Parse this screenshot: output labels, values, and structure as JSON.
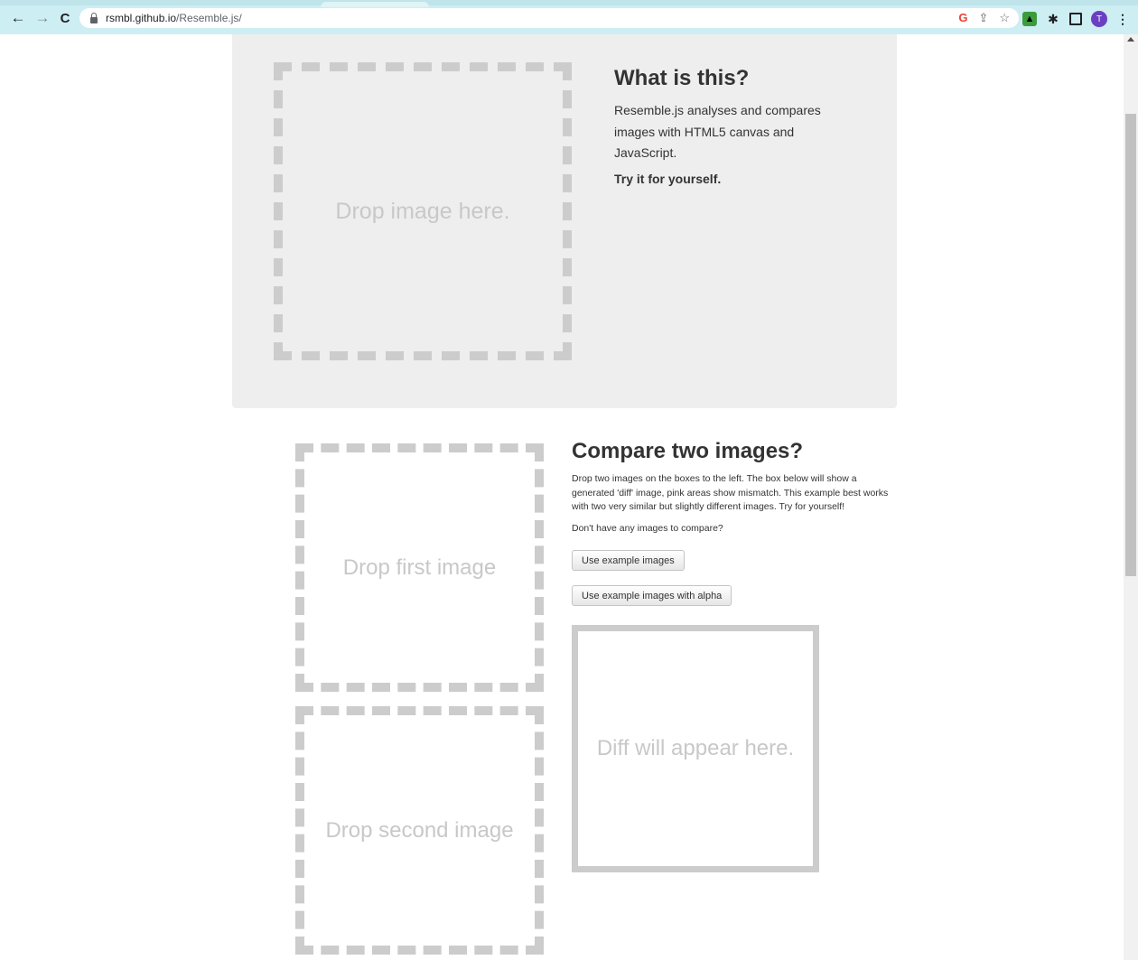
{
  "browser": {
    "url_host": "rsmbl.github.io",
    "url_path": "/Resemble.js/",
    "avatar_letter": "T"
  },
  "hero": {
    "drop_label": "Drop image here.",
    "title": "What is this?",
    "description": "Resemble.js analyses and compares images with HTML5 canvas and JavaScript.",
    "cta": "Try it for yourself."
  },
  "compare": {
    "first_drop_label": "Drop first image",
    "second_drop_label": "Drop second image",
    "title": "Compare two images?",
    "description": "Drop two images on the boxes to the left. The box below will show a generated 'diff' image, pink areas show mismatch. This example best works with two very similar but slightly different images. Try for yourself!",
    "question": "Don't have any images to compare?",
    "example_button": "Use example images",
    "example_alpha_button": "Use example images with alpha",
    "diff_label": "Diff will appear here."
  }
}
